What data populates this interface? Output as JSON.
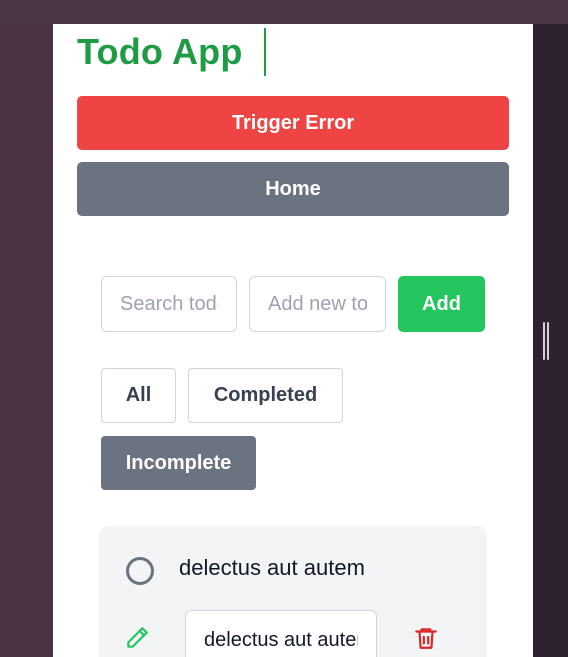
{
  "app": {
    "title": "Todo App"
  },
  "actions": {
    "trigger_error_label": "Trigger Error",
    "home_label": "Home"
  },
  "search": {
    "placeholder": "Search todos",
    "value": ""
  },
  "new_todo": {
    "placeholder": "Add new todo",
    "value": "",
    "add_label": "Add"
  },
  "filters": {
    "items": [
      {
        "label": "All"
      },
      {
        "label": "Completed"
      },
      {
        "label": "Incomplete"
      }
    ],
    "selected": "Incomplete"
  },
  "todos": [
    {
      "title": "delectus aut autem",
      "edit_value": "delectus aut autem",
      "completed": false
    }
  ],
  "icons": {
    "edit": "pencil-icon",
    "delete": "trash-icon",
    "status": "circle-icon"
  },
  "colors": {
    "title": "#1f9a45",
    "error": "#ef4444",
    "neutral": "#6b7280",
    "add": "#22c55e",
    "edit_icon": "#22c55e",
    "delete_icon": "#dc2626"
  }
}
